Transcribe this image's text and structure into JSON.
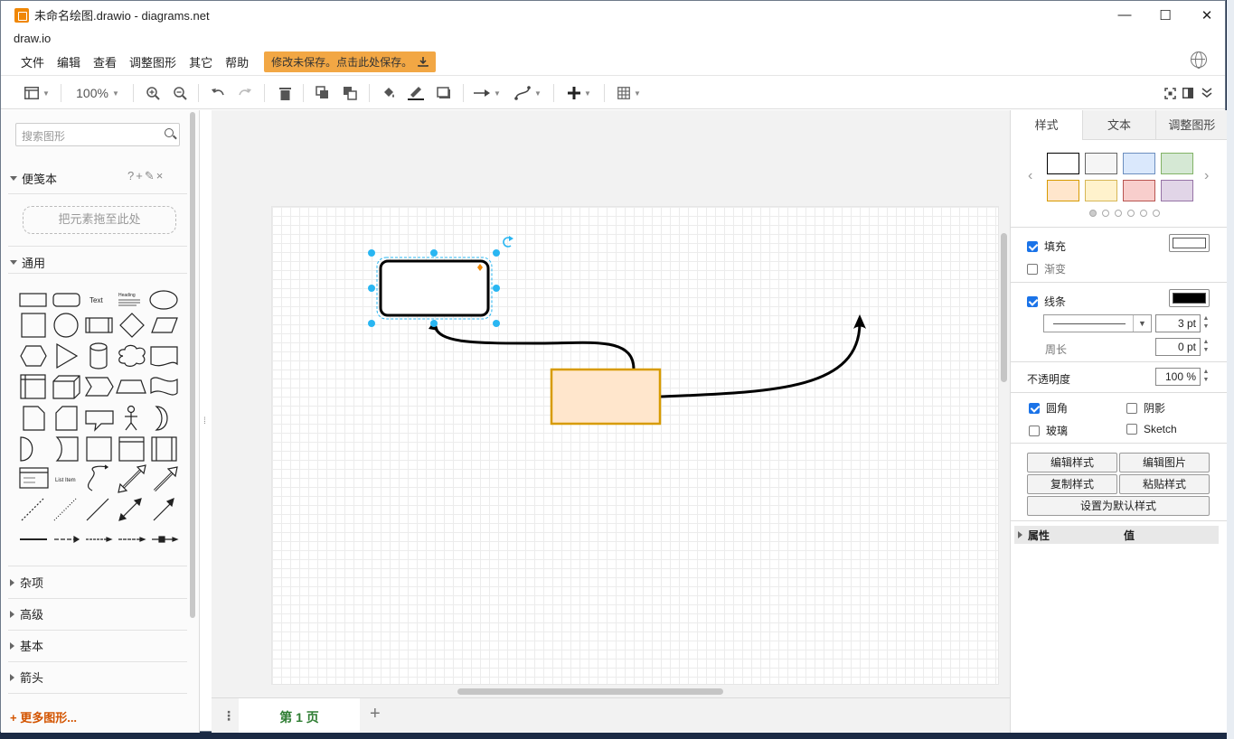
{
  "window": {
    "title": "未命名绘图.drawio - diagrams.net",
    "app_name": "draw.io",
    "controls": {
      "minimize": "—",
      "maximize": "☐",
      "close": "✕"
    }
  },
  "menu": {
    "items": [
      "文件",
      "编辑",
      "查看",
      "调整图形",
      "其它",
      "帮助"
    ],
    "save_notice": "修改未保存。点击此处保存。"
  },
  "toolbar": {
    "zoom": "100%",
    "icons": [
      "view-icon",
      "zoom-in-icon",
      "zoom-out-icon",
      "undo-icon",
      "redo-icon",
      "delete-icon",
      "to-front-icon",
      "to-back-icon",
      "fill-color-icon",
      "line-color-icon",
      "shadow-icon",
      "connection-icon",
      "waypoints-icon",
      "insert-icon",
      "table-icon",
      "fullscreen-icon",
      "format-panel-icon",
      "collapse-icon"
    ]
  },
  "sidebar": {
    "search_placeholder": "搜索图形",
    "scratchpad": {
      "title": "便笺本",
      "tools": "?+✎×",
      "drop_hint": "把元素拖至此处"
    },
    "general_title": "通用",
    "shape_labels": {
      "text": "Text",
      "heading": "Heading",
      "list": "List Item"
    },
    "collapsed_sections": [
      "杂项",
      "高级",
      "基本",
      "箭头"
    ],
    "more_shapes": "+ 更多图形..."
  },
  "pages": {
    "tabs": [
      "第 1 页"
    ],
    "menu_glyph": "⋮",
    "add_glyph": "+"
  },
  "format_panel": {
    "tabs": [
      "样式",
      "文本",
      "调整图形"
    ],
    "swatches": [
      "#ffffff",
      "#f5f5f5",
      "#dae8fc",
      "#d5e8d4",
      "#ffe6cc",
      "#fff2cc",
      "#f8cecc",
      "#e1d5e7"
    ],
    "swatch_borders": [
      "#000000",
      "#666666",
      "#6c8ebf",
      "#82b366",
      "#d79b00",
      "#d6b656",
      "#b85450",
      "#9673a6"
    ],
    "fill": {
      "label": "填充",
      "checked": true,
      "color": "#ffffff"
    },
    "gradient": {
      "label": "渐变",
      "checked": false
    },
    "line": {
      "label": "线条",
      "checked": true,
      "color": "#000000",
      "width": "3 pt"
    },
    "perimeter": {
      "label": "周长",
      "value": "0 pt"
    },
    "opacity": {
      "label": "不透明度",
      "value": "100 %"
    },
    "rounded": {
      "label": "圆角",
      "checked": true
    },
    "shadow": {
      "label": "阴影",
      "checked": false
    },
    "glass": {
      "label": "玻璃",
      "checked": false
    },
    "sketch": {
      "label": "Sketch",
      "checked": false
    },
    "buttons": {
      "edit_style": "编辑样式",
      "edit_image": "编辑图片",
      "copy_style": "复制样式",
      "paste_style": "粘贴样式",
      "set_default": "设置为默认样式"
    },
    "properties": {
      "name_header": "属性",
      "value_header": "值"
    }
  },
  "diagram": {
    "selected_shape": {
      "fill": "#ffffff",
      "stroke": "#000000",
      "rounded": true
    },
    "orange_shape": {
      "fill": "#ffe6cc",
      "stroke": "#d79b00"
    },
    "selection_color": "#29b6f2"
  }
}
